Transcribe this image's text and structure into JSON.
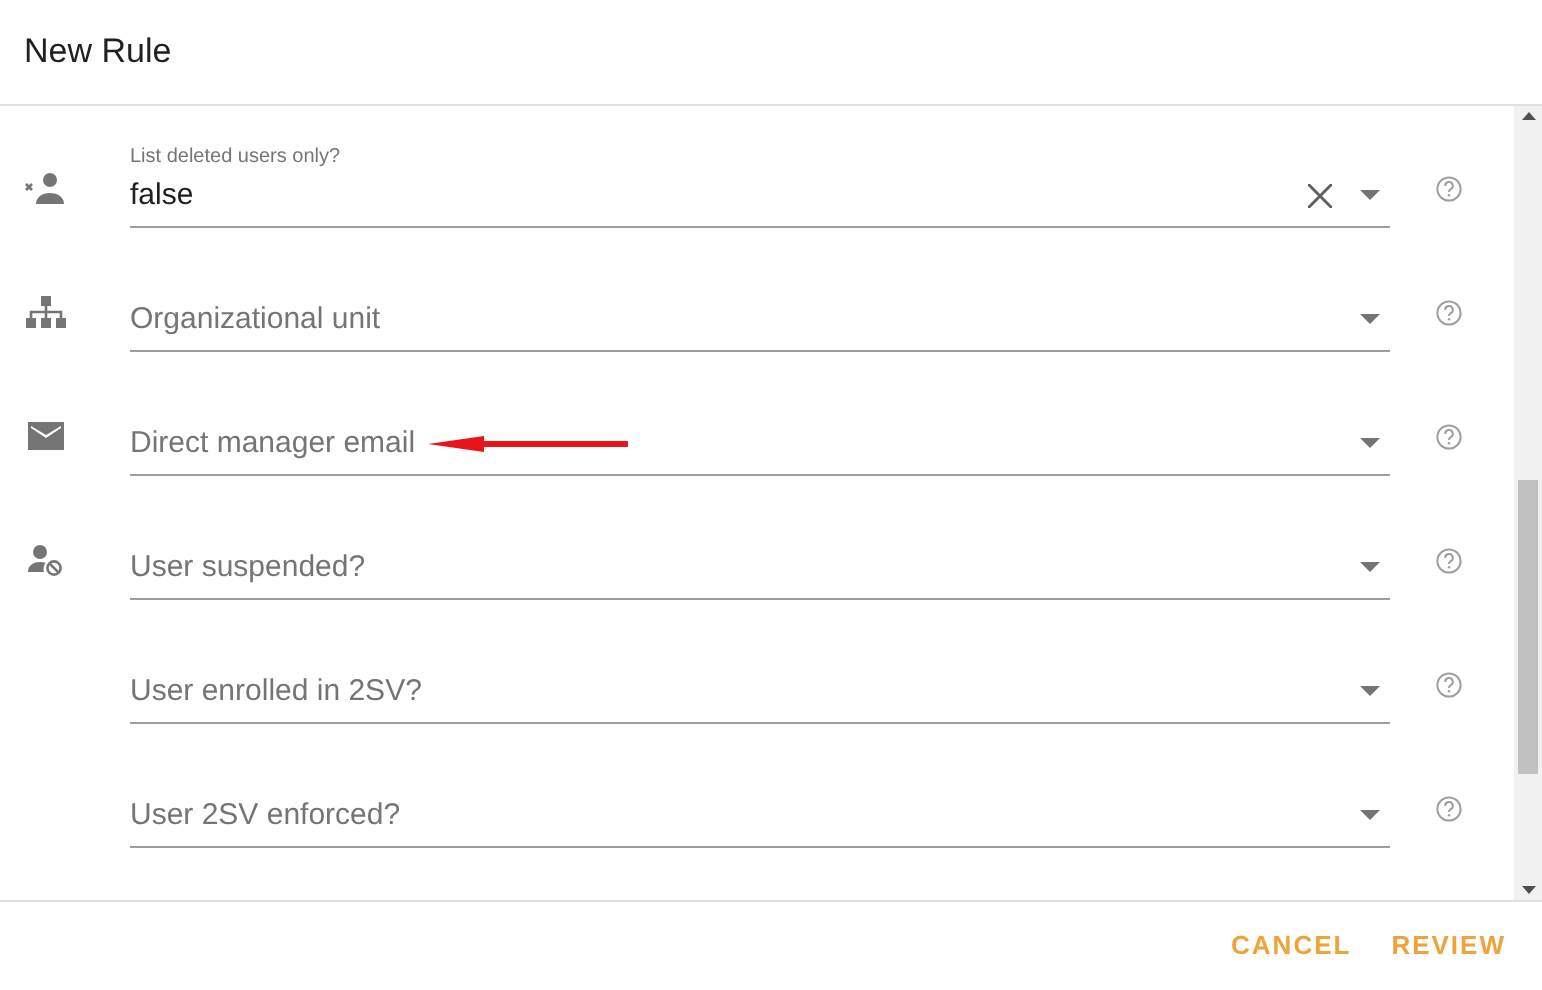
{
  "dialog": {
    "title": "New Rule"
  },
  "fields": [
    {
      "label": "List deleted users only?",
      "value": "false",
      "clearable": true
    },
    {
      "placeholder": "Organizational unit",
      "clearable": false
    },
    {
      "placeholder": "Direct manager email",
      "clearable": false
    },
    {
      "placeholder": "User suspended?",
      "clearable": false
    },
    {
      "placeholder": "User enrolled in 2SV?",
      "clearable": false
    },
    {
      "placeholder": "User 2SV enforced?",
      "clearable": false
    }
  ],
  "buttons": [
    "CANCEL",
    "REVIEW"
  ]
}
